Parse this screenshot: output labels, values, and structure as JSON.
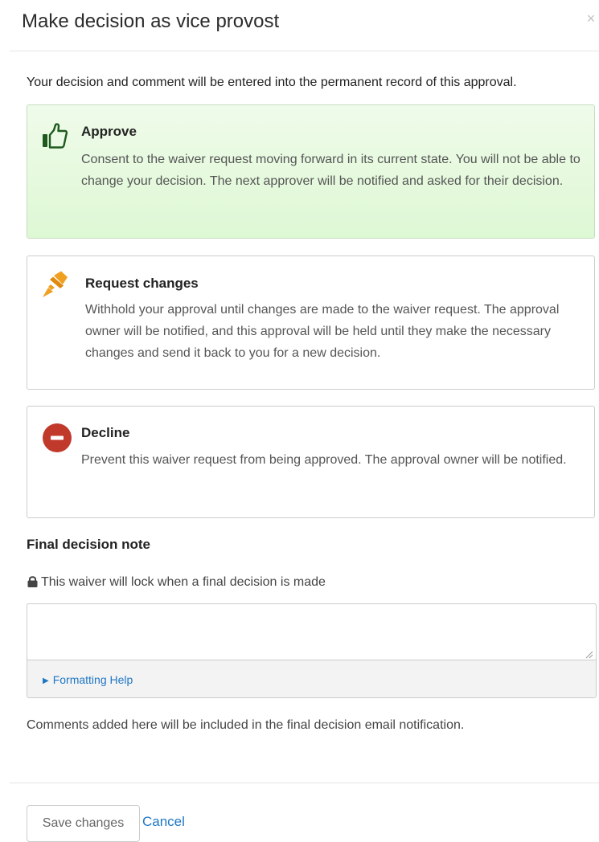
{
  "modal": {
    "title": "Make decision as vice provost",
    "close_label": "×"
  },
  "intro_text": "Your decision and comment will be entered into the permanent record of this approval.",
  "options": [
    {
      "id": "approve",
      "title": "Approve",
      "description": "Consent to the waiver request moving forward in its current state. You will not be able to change your decision. The next approver will be notified and asked for their decision.",
      "icon": "thumbs-up-icon",
      "icon_color": "#1e5a1e",
      "selected": true
    },
    {
      "id": "request-changes",
      "title": "Request changes",
      "description": "Withhold your approval until changes are made to the waiver request. The approval owner will be notified, and this approval will be held until they make the necessary changes and send it back to you for a new decision.",
      "icon": "highlighter-icon",
      "icon_color": "#f0a020",
      "selected": false
    },
    {
      "id": "decline",
      "title": "Decline",
      "description": "Prevent this waiver request from being approved. The approval owner will be notified.",
      "icon": "minus-circle-icon",
      "icon_color": "#c0392b",
      "selected": false
    }
  ],
  "final_note": {
    "label": "Final decision note",
    "lock_text": "This waiver will lock when a final decision is made",
    "textarea_value": "",
    "formatting_help": "Formatting Help",
    "helper_text": "Comments added here will be included in the final decision email notification."
  },
  "actions": {
    "save_label": "Save changes",
    "cancel_label": "Cancel"
  },
  "colors": {
    "selected_bg": "#def8d4",
    "link": "#1f77c4"
  }
}
